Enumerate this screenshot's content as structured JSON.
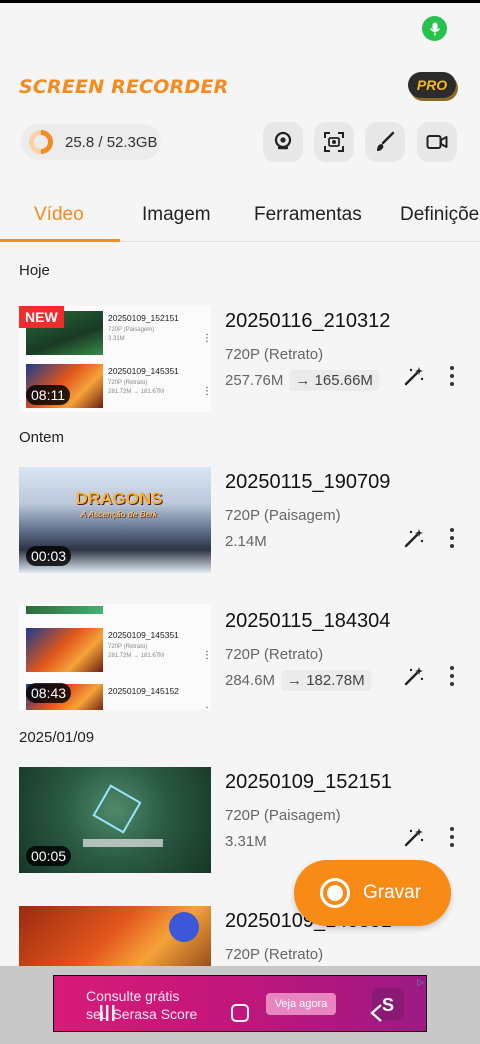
{
  "app": {
    "title": "SCREEN RECORDER",
    "pro_badge": "PRO"
  },
  "storage": {
    "text": "25.8 / 52.3GB",
    "used_fraction": 0.49
  },
  "toolbar": {
    "icons": [
      "map-pin-icon",
      "screenshot-icon",
      "brush-icon",
      "camera-icon"
    ]
  },
  "tabs": [
    {
      "label": "Vídeo",
      "active": true
    },
    {
      "label": "Imagem",
      "active": false
    },
    {
      "label": "Ferramentas",
      "active": false
    },
    {
      "label": "Definições",
      "active": false
    }
  ],
  "sections": {
    "today": "Hoje",
    "yesterday": "Ontem",
    "date": "2025/01/09"
  },
  "videos": [
    {
      "name": "20250116_210312",
      "resolution": "720P (Retrato)",
      "size": "257.76M",
      "compressed": "165.66M",
      "duration": "08:11",
      "new_tag": "NEW",
      "mini": [
        {
          "name": "20250109_152151",
          "sub": "720P (Paisagem)",
          "sub2": "3.31M"
        },
        {
          "name": "20250109_145351",
          "sub": "720P (Retrato)",
          "sub2": "281.72M → 181.67M"
        }
      ]
    },
    {
      "name": "20250115_190709",
      "resolution": "720P (Paisagem)",
      "size": "2.14M",
      "duration": "00:03",
      "thumb_title": "DRAGONS",
      "thumb_subtitle": "A Ascenção de Berk"
    },
    {
      "name": "20250115_184304",
      "resolution": "720P (Retrato)",
      "size": "284.6M",
      "compressed": "182.78M",
      "duration": "08:43",
      "mini": [
        {
          "name": "20250109_145351",
          "sub": "720P (Retrato)",
          "sub2": "281.72M → 181.67M"
        },
        {
          "name": "20250109_145152",
          "sub": "",
          "sub2": ""
        }
      ]
    },
    {
      "name": "20250109_152151",
      "resolution": "720P (Paisagem)",
      "size": "3.31M",
      "duration": "00:05"
    },
    {
      "name": "20250109_145351",
      "resolution": "720P (Retrato)"
    }
  ],
  "fab": {
    "label": "Gravar"
  },
  "ad": {
    "line1": "Consulte grátis",
    "line2": "seu Serasa Score",
    "button": "Veja agora"
  },
  "colors": {
    "accent": "#f58a1f",
    "new_tag": "#ef2b2b",
    "mic": "#27c24c"
  }
}
